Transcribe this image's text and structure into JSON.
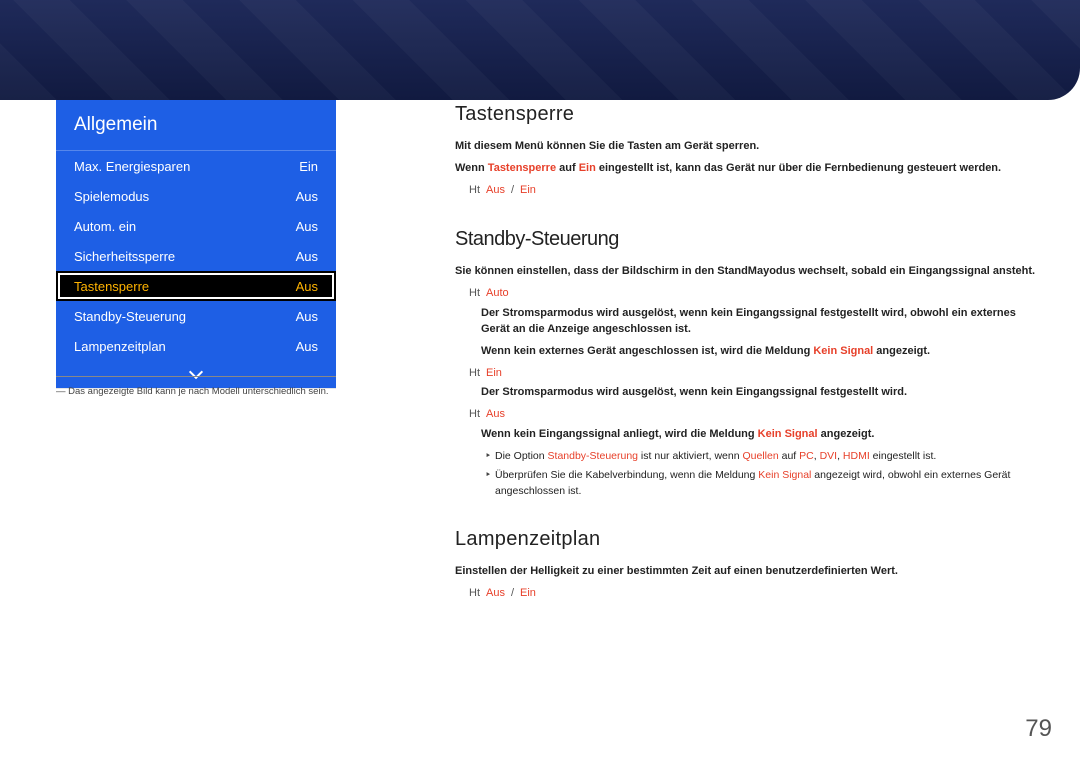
{
  "pageNumber": "79",
  "menu": {
    "title": "Allgemein",
    "items": [
      {
        "label": "Max. Energiesparen",
        "value": "Ein",
        "selected": false
      },
      {
        "label": "Spielemodus",
        "value": "Aus",
        "selected": false
      },
      {
        "label": "Autom. ein",
        "value": "Aus",
        "selected": false
      },
      {
        "label": "Sicherheitssperre",
        "value": "Aus",
        "selected": false
      },
      {
        "label": "Tastensperre",
        "value": "Aus",
        "selected": true
      },
      {
        "label": "Standby-Steuerung",
        "value": "Aus",
        "selected": false
      },
      {
        "label": "Lampenzeitplan",
        "value": "Aus",
        "selected": false
      }
    ]
  },
  "footnote": "Das angezeigte Bild kann je nach Modell unterschiedlich sein.",
  "pencilPrefix": "Ht",
  "sections": {
    "tastensperre": {
      "title": "Tastensperre",
      "intro": "Mit diesem Menü können Sie die Tasten am Gerät sperren.",
      "note_pre": "Wenn ",
      "note_hl1": "Tastensperre",
      "note_mid": " auf ",
      "note_hl2": "Ein",
      "note_post": " eingestellt ist, kann das Gerät nur über die Fernbedienung gesteuert werden.",
      "options": {
        "a": "Aus",
        "sep": "/",
        "b": "Ein"
      }
    },
    "standby": {
      "title": "Standby-Steuerung",
      "intro_pre": "Sie können einstellen, dass der Bildschirm in den Stand",
      "intro_mid": "May",
      "intro_post": "odus wechselt, sobald ein Eingangssignal ansteht.",
      "opts": [
        {
          "value": "Auto",
          "desc1": "Der Stromsparmodus wird ausgelöst, wenn kein Eingangssignal festgestellt wird, obwohl ein externes Gerät an die Anzeige angeschlossen ist.",
          "desc2_pre": "Wenn kein externes Gerät angeschlossen ist, wird die Meld",
          "desc2_hl": "Kein Signal",
          "desc2_mid": "ung ",
          "desc2_post": " angezeigt."
        },
        {
          "value": "Ein",
          "desc1": "Der Stromsparmodus wird ausgelöst, wenn kein Eingangssignal festgestellt wird."
        },
        {
          "value": "Aus",
          "desc1_pre": "Wenn kein Eingangssignal anliegt, wird die Meldung ",
          "desc1_hl": "Kein Signal",
          "desc1_post": " angezeigt."
        }
      ],
      "notes": [
        {
          "pre": "Die Option ",
          "hl1": "Standby-Steuerung",
          "mid1": " ist nur aktiviert, wenn ",
          "hl2": "Quellen",
          "mid2": " auf ",
          "hl3": "PC",
          "mid3": ", ",
          "hl4": "DVI",
          "mid4": ", ",
          "hl5": "HDMI",
          "post": " eingestellt ist."
        },
        {
          "pre": "Überprüfen Sie die Kabelverbindung, wenn die Meldung ",
          "hl1": "Kein Signal",
          "post": " angezeigt wird, obwohl ein externes Gerät angeschlossen ist."
        }
      ]
    },
    "lampenzeitplan": {
      "title": "Lampenzeitplan",
      "intro": "Einstellen der Helligkeit zu einer bestimmten Zeit auf einen benutzerdefinierten Wert.",
      "options": {
        "a": "Aus",
        "sep": "/",
        "b": "Ein"
      }
    }
  }
}
